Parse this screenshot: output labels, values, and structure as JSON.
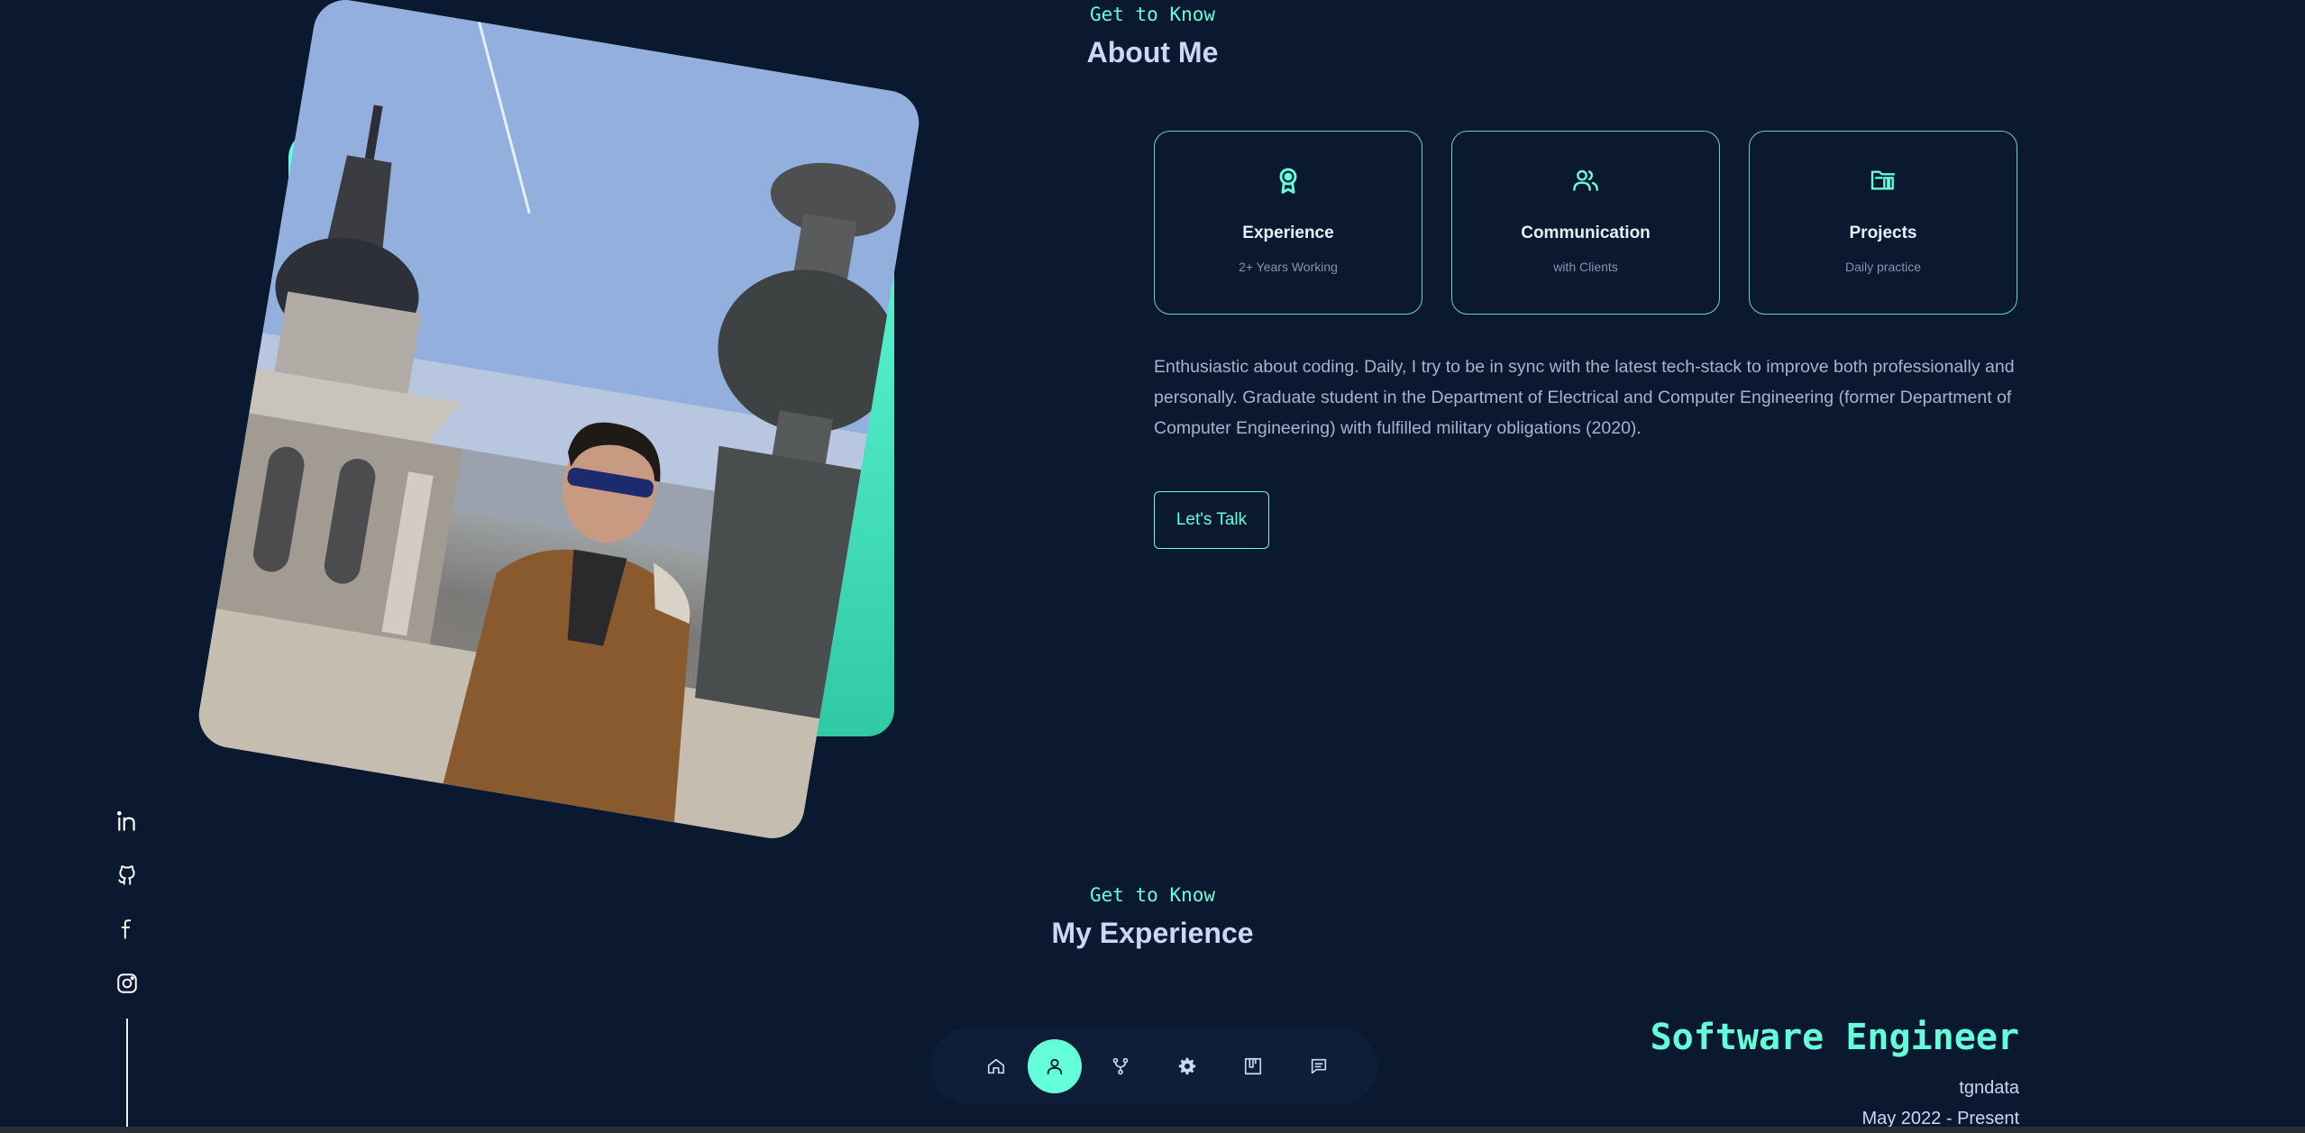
{
  "about": {
    "eyebrow": "Get to Know",
    "title": "About Me",
    "cards": [
      {
        "icon": "award-icon",
        "title": "Experience",
        "subtitle": "2+ Years Working"
      },
      {
        "icon": "users-icon",
        "title": "Communication",
        "subtitle": "with Clients"
      },
      {
        "icon": "folder-icon",
        "title": "Projects",
        "subtitle": "Daily practice"
      }
    ],
    "paragraph": "Enthusiastic about coding. Daily, I try to be in sync with the latest tech-stack to improve both professionally and personally. Graduate student in the Department of Electrical and Computer Engineering (former Department of Computer Engineering) with fulfilled military obligations (2020).",
    "cta_label": "Let's Talk"
  },
  "experience": {
    "eyebrow": "Get to Know",
    "title": "My Experience",
    "job": {
      "title": "Software Engineer",
      "company": "tgndata",
      "dates": "May 2022 - Present"
    }
  },
  "social": [
    "linkedin-icon",
    "github-icon",
    "facebook-icon",
    "instagram-icon"
  ],
  "nav": {
    "items": [
      "home-icon",
      "user-icon",
      "git-branch-icon",
      "gear-icon",
      "portfolio-icon",
      "message-icon"
    ],
    "active": "user-icon"
  },
  "colors": {
    "background": "#0a1830",
    "accent": "#64ffda",
    "text": "#ccd6f6",
    "muted": "#a8b2d1"
  }
}
